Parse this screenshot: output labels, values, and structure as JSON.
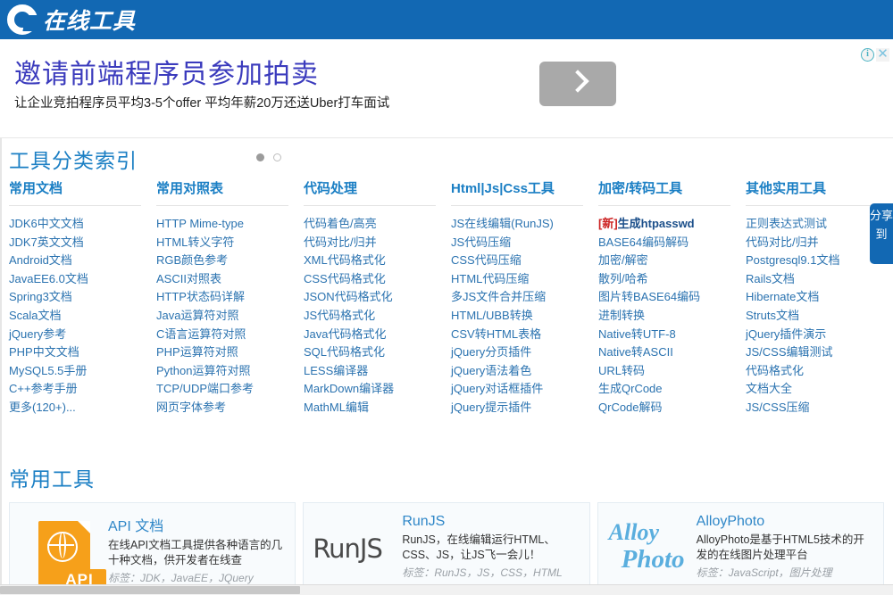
{
  "header": {
    "logo_icon": "letter-c-logo",
    "site_name": "在线工具"
  },
  "ad": {
    "headline": "邀请前端程序员参加拍卖",
    "subtext": "让企业竞拍程序员平均3-5个offer 平均年薪20万还送Uber打车面试",
    "cta_icon": "chevron-right-icon",
    "info_icon": "i",
    "close_icon": "✕",
    "dots": [
      "active",
      "inactive"
    ]
  },
  "sections": {
    "index_title": "工具分类索引",
    "tools_title": "常用工具"
  },
  "share": {
    "label": "分享到"
  },
  "columns": [
    {
      "header": "常用文档",
      "items": [
        "JDK6中文文档",
        "JDK7英文文档",
        "Android文档",
        "JavaEE6.0文档",
        "Spring3文档",
        "Scala文档",
        "jQuery参考",
        "PHP中文文档",
        "MySQL5.5手册",
        "C++参考手册",
        "更多(120+)..."
      ]
    },
    {
      "header": "常用对照表",
      "items": [
        "HTTP Mime-type",
        "HTML转义字符",
        "RGB颜色参考",
        "ASCII对照表",
        "HTTP状态码详解",
        "Java运算符对照",
        "C语言运算符对照",
        "PHP运算符对照",
        "Python运算符对照",
        "TCP/UDP端口参考",
        "网页字体参考"
      ]
    },
    {
      "header": "代码处理",
      "items": [
        "代码着色/高亮",
        "代码对比/归并",
        "XML代码格式化",
        "CSS代码格式化",
        "JSON代码格式化",
        "JS代码格式化",
        "Java代码格式化",
        "SQL代码格式化",
        "LESS编译器",
        "MarkDown编译器",
        "MathML编辑"
      ]
    },
    {
      "header": "Html|Js|Css工具",
      "items": [
        "JS在线编辑(RunJS)",
        "JS代码压缩",
        "CSS代码压缩",
        "HTML代码压缩",
        "多JS文件合并压缩",
        "HTML/UBB转换",
        "CSV转HTML表格",
        "jQuery分页插件",
        "jQuery语法着色",
        "jQuery对话框插件",
        "jQuery提示插件"
      ]
    },
    {
      "header": "加密/转码工具",
      "items": [
        "[新]生成htpasswd",
        "BASE64编码解码",
        "加密/解密",
        "散列/哈希",
        "图片转BASE64编码",
        "进制转换",
        "Native转UTF-8",
        "Native转ASCII",
        "URL转码",
        "生成QrCode",
        "QrCode解码"
      ],
      "highlight_index": 0,
      "highlight_tag": "[新]",
      "highlight_rest": "生成htpasswd"
    },
    {
      "header": "其他实用工具",
      "items": [
        "正则表达式测试",
        "代码对比/归并",
        "Postgresql9.1文档",
        "Rails文档",
        "Hibernate文档",
        "Struts文档",
        "jQuery插件演示",
        "JS/CSS编辑测试",
        "代码格式化",
        "文档大全",
        "JS/CSS压缩"
      ]
    }
  ],
  "cards": [
    {
      "icon": "api-document-icon",
      "title": "API 文档",
      "desc": "在线API文档工具提供各种语言的几十种文档，供开发者在线查",
      "tags": "标签：JDK，JavaEE，JQuery",
      "icon_label": "API"
    },
    {
      "icon": "runjs-logo-icon",
      "title": "RunJS",
      "desc": "RunJS，在线编辑运行HTML、CSS、JS，让JS飞一会儿！",
      "tags": "标签：RunJS，JS，CSS，HTML",
      "icon_label": "RunJS"
    },
    {
      "icon": "alloyphoto-logo-icon",
      "title": "AlloyPhoto",
      "desc": "AlloyPhoto是基于HTML5技术的开发的在线图片处理平台",
      "tags": "标签：JavaScript，图片处理",
      "icon_label_1": "Alloy",
      "icon_label_2": "Photo"
    }
  ],
  "theme": {
    "brand_blue": "#1268b3",
    "link_blue": "#2b73b0",
    "title_blue": "#1b7fc4",
    "accent_orange": "#f6a01a",
    "new_red": "#cc2222"
  }
}
